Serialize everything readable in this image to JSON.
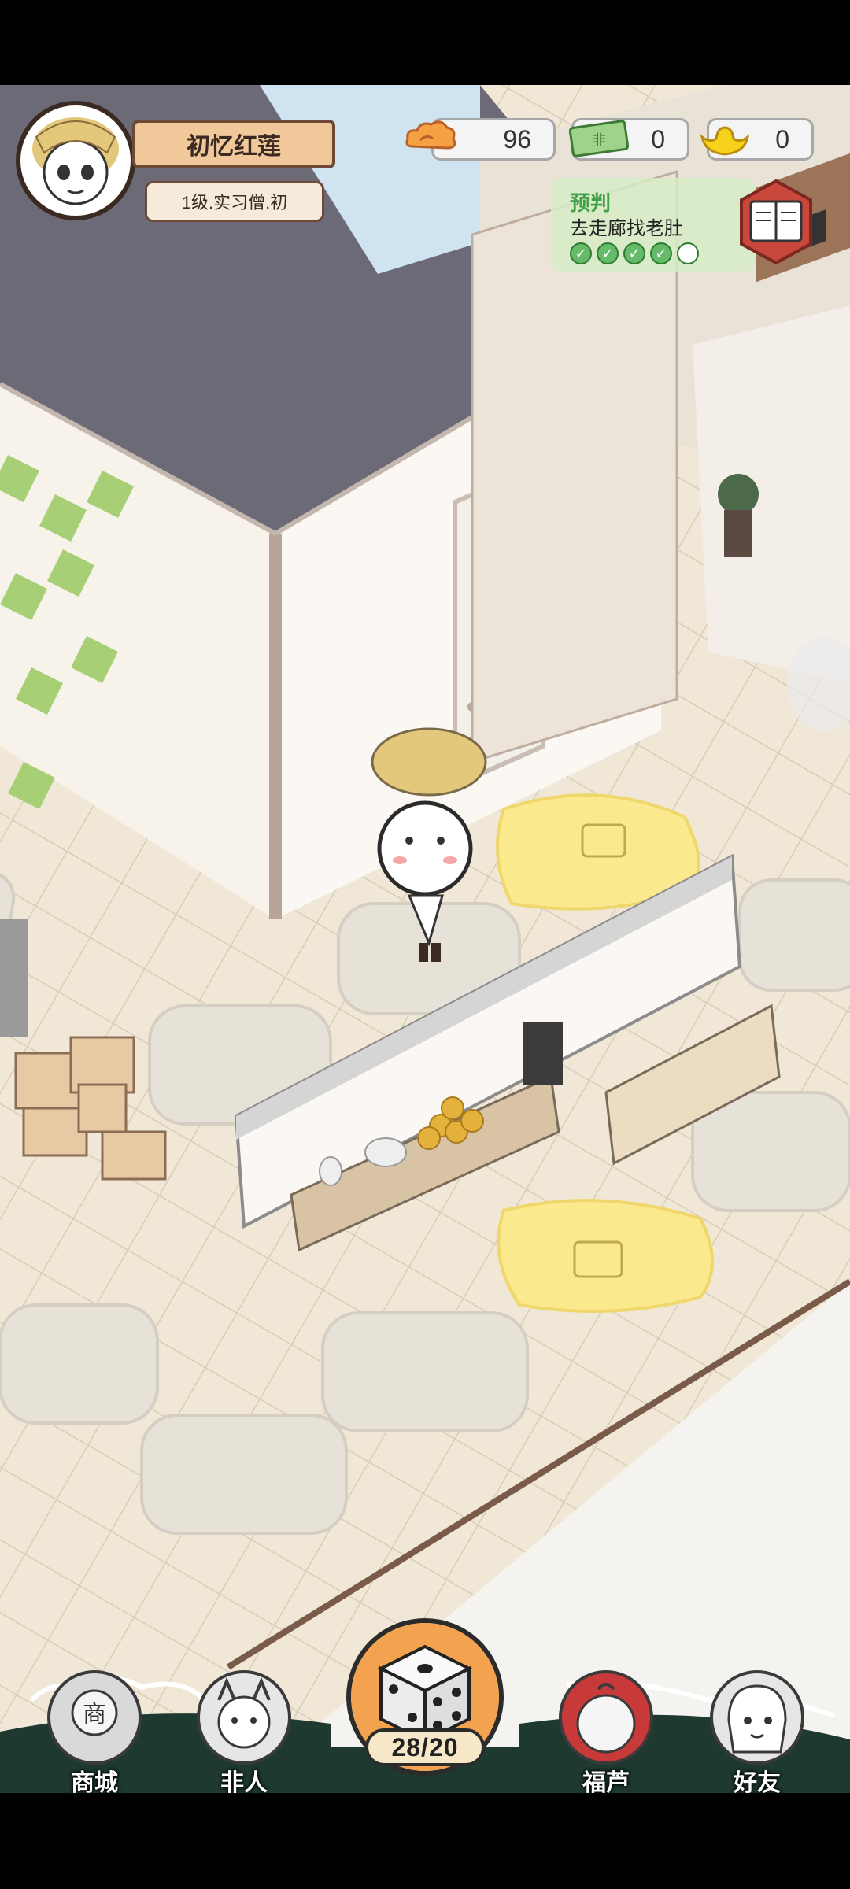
{
  "player": {
    "name": "初忆红莲",
    "rank": "1级.实习僧.初"
  },
  "resources": {
    "cloud_value": "96",
    "cash_value": "0",
    "cash_icon_text": "非",
    "gold_value": "0"
  },
  "task": {
    "title": "预判",
    "description": "去走廊找老肚",
    "progress_done": 4,
    "progress_total": 5
  },
  "dice": {
    "count": "28/20"
  },
  "nav": {
    "shop": "商城",
    "shop_icon_text": "商",
    "feiren": "非人",
    "fulu": "福芦",
    "friends": "好友"
  },
  "colors": {
    "floor": "#efe6d6",
    "wall_roof": "#6d6a78",
    "green_tile": "#a6cf76",
    "yellow_mat": "#fbe98e",
    "nav_band": "#1e3a30"
  }
}
